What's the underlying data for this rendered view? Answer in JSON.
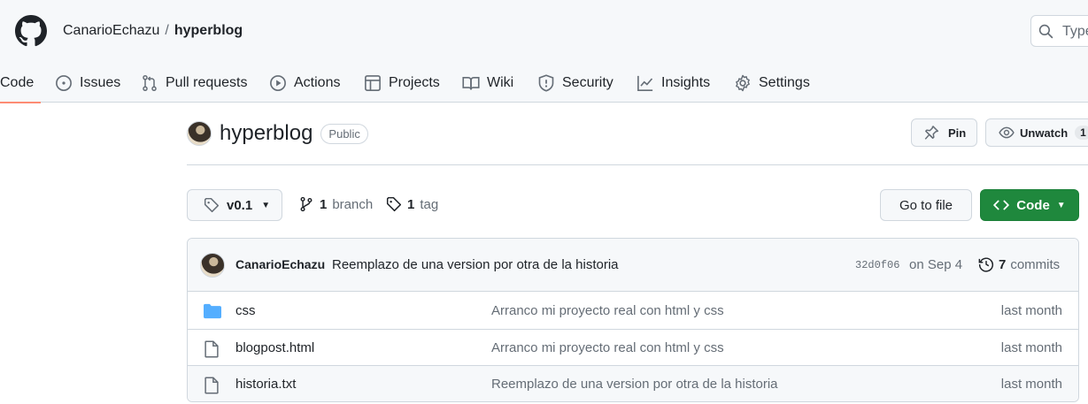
{
  "colors": {
    "accent_underline": "#fd8c73",
    "code_button": "#1f883d",
    "folder": "#54aeff"
  },
  "header": {
    "owner": "CanarioEchazu",
    "separator": "/",
    "repo": "hyperblog",
    "search_placeholder": "Type"
  },
  "nav": {
    "tabs": [
      {
        "label": "Code",
        "icon": "code-icon",
        "active": true
      },
      {
        "label": "Issues",
        "icon": "issue-opened-icon"
      },
      {
        "label": "Pull requests",
        "icon": "git-pull-request-icon"
      },
      {
        "label": "Actions",
        "icon": "play-icon"
      },
      {
        "label": "Projects",
        "icon": "table-icon"
      },
      {
        "label": "Wiki",
        "icon": "book-icon"
      },
      {
        "label": "Security",
        "icon": "shield-icon"
      },
      {
        "label": "Insights",
        "icon": "graph-icon"
      },
      {
        "label": "Settings",
        "icon": "gear-icon"
      }
    ]
  },
  "repo_header": {
    "name": "hyperblog",
    "visibility": "Public",
    "pin_label": "Pin",
    "watch_label": "Unwatch",
    "watch_count": "1"
  },
  "toolbar": {
    "tag_selector": "v0.1",
    "branch_count": "1",
    "branch_label": "branch",
    "tag_count": "1",
    "tag_label": "tag",
    "go_to_file": "Go to file",
    "code_button": "Code"
  },
  "latest_commit": {
    "author": "CanarioEchazu",
    "message": "Reemplazo de una version por otra de la historia",
    "sha": "32d0f06",
    "date": "on Sep 4",
    "commit_count": "7",
    "commit_label": "commits"
  },
  "files": [
    {
      "type": "dir",
      "name": "css",
      "message": "Arranco mi proyecto real con html y css",
      "age": "last month"
    },
    {
      "type": "file",
      "name": "blogpost.html",
      "message": "Arranco mi proyecto real con html y css",
      "age": "last month"
    },
    {
      "type": "file",
      "name": "historia.txt",
      "message": "Reemplazo de una version por otra de la historia",
      "age": "last month"
    }
  ]
}
